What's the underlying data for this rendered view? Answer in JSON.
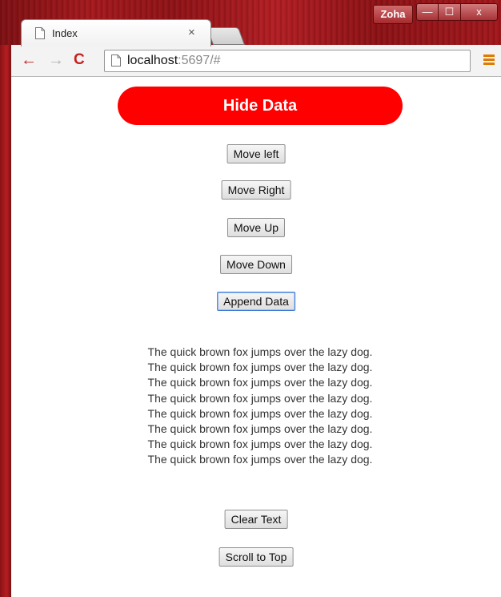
{
  "window": {
    "user_name": "Zoha",
    "minimize_glyph": "—",
    "maximize_glyph": "☐",
    "close_glyph": "x"
  },
  "tab": {
    "title": "Index",
    "close_glyph": "×"
  },
  "toolbar": {
    "back_glyph": "←",
    "forward_glyph": "→",
    "reload_glyph": "C",
    "url_host": "localhost",
    "url_rest": ":5697/#",
    "star_glyph": "☆"
  },
  "page": {
    "hide_data_label": "Hide Data",
    "move_left_label": "Move left",
    "move_right_label": "Move Right",
    "move_up_label": "Move Up",
    "move_down_label": "Move Down",
    "append_data_label": "Append Data",
    "text_lines": [
      "The quick brown fox jumps over the lazy dog.",
      "The quick brown fox jumps over the lazy dog.",
      "The quick brown fox jumps over the lazy dog.",
      "The quick brown fox jumps over the lazy dog.",
      "The quick brown fox jumps over the lazy dog.",
      "The quick brown fox jumps over the lazy dog.",
      "The quick brown fox jumps over the lazy dog.",
      "The quick brown fox jumps over the lazy dog."
    ],
    "clear_text_label": "Clear Text",
    "scroll_top_label": "Scroll to Top"
  },
  "colors": {
    "hide_button_bg": "#ff0000",
    "frame_red": "#a3181c",
    "nav_red": "#c62121",
    "menu_orange": "#e07b00"
  },
  "icons": {
    "tab_page": "page-icon",
    "omnibox_page": "page-icon",
    "bookmark": "star-icon",
    "menu": "hamburger-menu-icon"
  }
}
